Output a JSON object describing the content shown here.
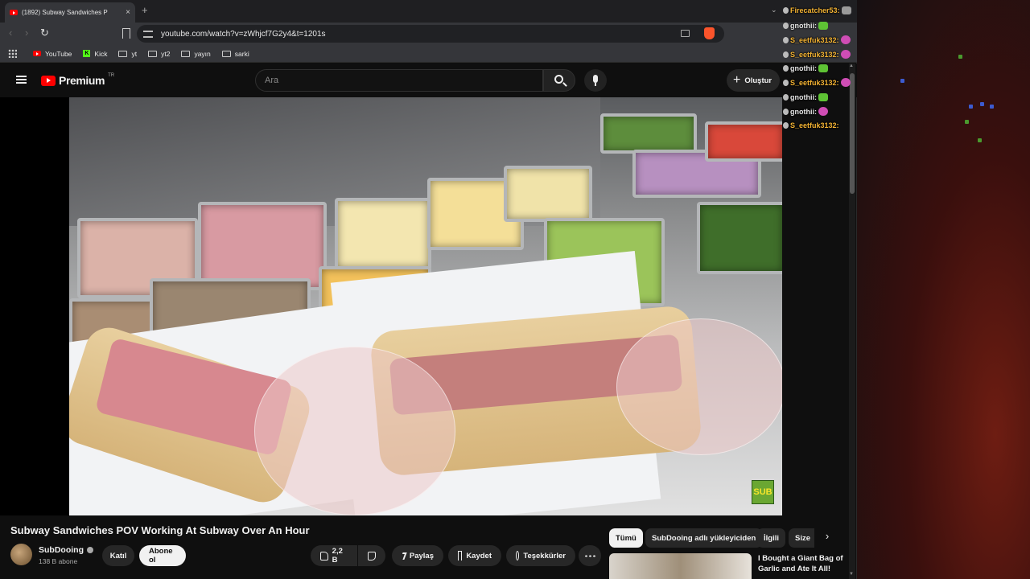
{
  "browser": {
    "tab_title": "(1892) Subway Sandwiches P",
    "tab_close": "×",
    "new_tab": "+",
    "tabs_menu": "⌄",
    "back": "‹",
    "forward": "›",
    "reload": "↻",
    "url": "youtube.com/watch?v=zWhjcf7G2y4&t=1201s",
    "bookmarks": [
      "YouTube",
      "Kick",
      "yt",
      "yt2",
      "yayın",
      "sarki"
    ]
  },
  "youtube": {
    "brand": "Premium",
    "region": "TR",
    "search_placeholder": "Ara",
    "create_label": "Oluştur",
    "create_icon": "+",
    "video_title": "Subway Sandwiches POV Working At Subway Over An Hour",
    "channel_name": "SubDooing",
    "subscriber_count": "138 B abone",
    "join_label": "Katıl",
    "subscribe_label": "Abone ol",
    "like_count": "2,2 B",
    "share_label": "Paylaş",
    "save_label": "Kaydet",
    "thanks_label": "Teşekkürler",
    "chips": [
      "Tümü",
      "SubDooing adlı yükleyiciden",
      "İlgili",
      "Size"
    ],
    "chip_next": "›",
    "recommendation_title": "I Bought a Giant Bag of Garlic and Ate It All!",
    "watermark": "SUB"
  },
  "chat": [
    {
      "user": "Firecatcher53:",
      "color": "#f2b233",
      "emote": "gray"
    },
    {
      "user": "gnothii:",
      "color": "#e6e6e6",
      "emote": "green"
    },
    {
      "user": "S_eetfuk3132:",
      "color": "#f2b233",
      "emote": "pink"
    },
    {
      "user": "S_eetfuk3132:",
      "color": "#f2b233",
      "emote": "pink"
    },
    {
      "user": "gnothii:",
      "color": "#e6e6e6",
      "emote": "green"
    },
    {
      "user": "S_eetfuk3132:",
      "color": "#f2b233",
      "emote": "pink"
    },
    {
      "user": "gnothii:",
      "color": "#e6e6e6",
      "emote": "green"
    },
    {
      "user": "gnothii:",
      "color": "#e6e6e6",
      "emote": "pink"
    },
    {
      "user": "S_eetfuk3132:",
      "color": "#f2b233",
      "emote": "none"
    }
  ],
  "colors": {
    "accent_red": "#ff0000",
    "chat_name_gold": "#f2b233",
    "subway_green": "#6aa732"
  }
}
